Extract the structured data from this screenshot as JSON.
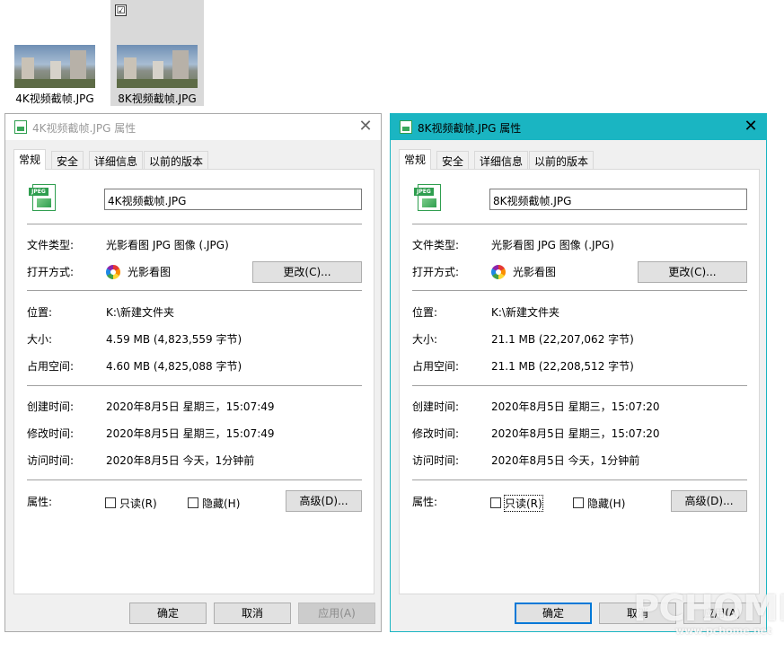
{
  "desktop": {
    "files": [
      {
        "name": "4K视频截帧.JPG",
        "selected": false
      },
      {
        "name": "8K视频截帧.JPG",
        "selected": true,
        "check_mark": "☑"
      }
    ]
  },
  "dialogs": [
    {
      "title": "4K视频截帧.JPG 属性",
      "active": false,
      "close_glyph": "✕",
      "tabs": [
        "常规",
        "安全",
        "详细信息",
        "以前的版本"
      ],
      "icon_badge": "JPEG",
      "filename": "4K视频截帧.JPG",
      "type_label": "文件类型:",
      "type_value": "光影看图 JPG 图像 (.JPG)",
      "opens_label": "打开方式:",
      "opens_value": "光影看图",
      "change_button": "更改(C)...",
      "location_label": "位置:",
      "location_value": "K:\\新建文件夹",
      "size_label": "大小:",
      "size_value": "4.59 MB (4,823,559 字节)",
      "disk_label": "占用空间:",
      "disk_value": "4.60 MB (4,825,088 字节)",
      "created_label": "创建时间:",
      "created_value": "2020年8月5日 星期三，15:07:49",
      "modified_label": "修改时间:",
      "modified_value": "2020年8月5日 星期三，15:07:49",
      "accessed_label": "访问时间:",
      "accessed_value": "2020年8月5日 今天，1分钟前",
      "attr_label": "属性:",
      "readonly_label": "只读(R)",
      "hidden_label": "隐藏(H)",
      "advanced_button": "高级(D)...",
      "ok_button": "确定",
      "cancel_button": "取消",
      "apply_button": "应用(A)"
    },
    {
      "title": "8K视频截帧.JPG 属性",
      "active": true,
      "close_glyph": "✕",
      "tabs": [
        "常规",
        "安全",
        "详细信息",
        "以前的版本"
      ],
      "icon_badge": "JPEG",
      "filename": "8K视频截帧.JPG",
      "type_label": "文件类型:",
      "type_value": "光影看图 JPG 图像 (.JPG)",
      "opens_label": "打开方式:",
      "opens_value": "光影看图",
      "change_button": "更改(C)...",
      "location_label": "位置:",
      "location_value": "K:\\新建文件夹",
      "size_label": "大小:",
      "size_value": "21.1 MB (22,207,062 字节)",
      "disk_label": "占用空间:",
      "disk_value": "21.1 MB (22,208,512 字节)",
      "created_label": "创建时间:",
      "created_value": "2020年8月5日 星期三，15:07:20",
      "modified_label": "修改时间:",
      "modified_value": "2020年8月5日 星期三，15:07:20",
      "accessed_label": "访问时间:",
      "accessed_value": "2020年8月5日 今天，1分钟前",
      "attr_label": "属性:",
      "readonly_label": "只读(R)",
      "hidden_label": "隐藏(H)",
      "advanced_button": "高级(D)...",
      "ok_button": "确定",
      "cancel_button": "取消",
      "apply_button": "应用(A)"
    }
  ],
  "watermark": {
    "text": "PCHOME",
    "sub": "www.pchome.net"
  }
}
